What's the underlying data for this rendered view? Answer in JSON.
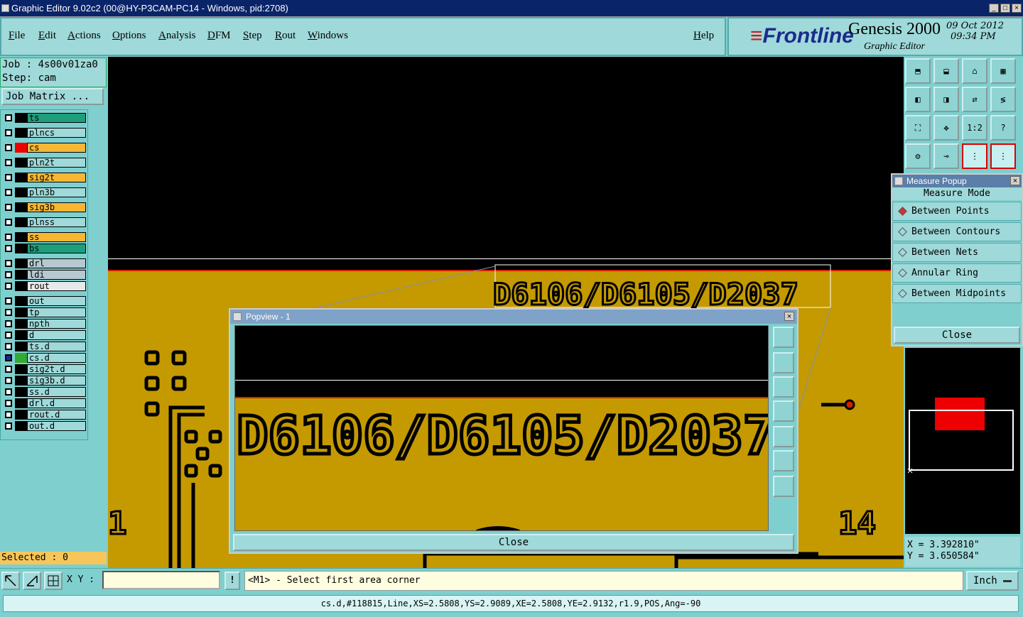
{
  "window": {
    "title": "Graphic Editor 9.02c2 (00@HY-P3CAM-PC14 - Windows, pid:2708)"
  },
  "menu": {
    "items": [
      "File",
      "Edit",
      "Actions",
      "Options",
      "Analysis",
      "DFM",
      "Step",
      "Rout",
      "Windows"
    ],
    "help": "Help"
  },
  "logo": {
    "brand": "Frontline",
    "product": "Genesis 2000",
    "subtitle": "Graphic Editor",
    "date": "09 Oct 2012",
    "time": "09:34 PM"
  },
  "job": {
    "job_line": "Job : 4s00v01za0",
    "step_line": "Step: cam",
    "matrix_button": "Job Matrix ..."
  },
  "layers": [
    {
      "name": "ts",
      "color": "#1e9e7a",
      "swatch": "#000",
      "mark": "↲"
    },
    {
      "name": "plncs",
      "color": "#9fd9d9",
      "swatch": "#000",
      "mark": ""
    },
    {
      "name": "cs",
      "color": "#f7b733",
      "swatch": "#e00",
      "mark": "↲"
    },
    {
      "name": "pln2t",
      "color": "#9fd9d9",
      "swatch": "#000",
      "mark": ""
    },
    {
      "name": "sig2t",
      "color": "#f7b733",
      "swatch": "#000",
      "mark": ""
    },
    {
      "name": "pln3b",
      "color": "#9fd9d9",
      "swatch": "#000",
      "mark": ""
    },
    {
      "name": "sig3b",
      "color": "#f7b733",
      "swatch": "#000",
      "mark": ""
    },
    {
      "name": "plnss",
      "color": "#9fd9d9",
      "swatch": "#000",
      "mark": ""
    },
    {
      "name": "ss",
      "color": "#f7b733",
      "swatch": "#000",
      "mark": "↲"
    },
    {
      "name": "bs",
      "color": "#1e9e7a",
      "swatch": "#000",
      "mark": ""
    },
    {
      "name": "drl",
      "color": "#b8c8d0",
      "swatch": "#000",
      "mark": ""
    },
    {
      "name": "ldi",
      "color": "#b8c8d0",
      "swatch": "#000",
      "mark": ""
    },
    {
      "name": "rout",
      "color": "#e8e8e8",
      "swatch": "#000",
      "mark": ""
    },
    {
      "name": "out",
      "color": "#9fd9d9",
      "swatch": "#000",
      "mark": ""
    },
    {
      "name": "tp",
      "color": "#9fd9d9",
      "swatch": "#000",
      "mark": ""
    },
    {
      "name": "npth",
      "color": "#9fd9d9",
      "swatch": "#000",
      "mark": ""
    },
    {
      "name": "d",
      "color": "#9fd9d9",
      "swatch": "#000",
      "mark": ""
    },
    {
      "name": "ts.d",
      "color": "#9fd9d9",
      "swatch": "#000",
      "mark": "↲"
    },
    {
      "name": "cs.d",
      "color": "#9fd9d9",
      "swatch": "#3a3",
      "mark": "↲⊞"
    },
    {
      "name": "sig2t.d",
      "color": "#9fd9d9",
      "swatch": "#000",
      "mark": ""
    },
    {
      "name": "sig3b.d",
      "color": "#9fd9d9",
      "swatch": "#000",
      "mark": ""
    },
    {
      "name": "ss.d",
      "color": "#9fd9d9",
      "swatch": "#000",
      "mark": "↲"
    },
    {
      "name": "drl.d",
      "color": "#9fd9d9",
      "swatch": "#000",
      "mark": ""
    },
    {
      "name": "rout.d",
      "color": "#9fd9d9",
      "swatch": "#000",
      "mark": ""
    },
    {
      "name": "out.d",
      "color": "#9fd9d9",
      "swatch": "#000",
      "mark": ""
    }
  ],
  "selected": "Selected : 0",
  "canvas": {
    "label": "D6106/D6105/D2037",
    "num_left": "1",
    "num_right": "14"
  },
  "toolbar": {
    "buttons": [
      "",
      "",
      "",
      "",
      "",
      "",
      "",
      "",
      "",
      "",
      "1:2",
      "?",
      "",
      "",
      "",
      ""
    ]
  },
  "measure": {
    "title": "Measure Popup",
    "header": "Measure Mode",
    "options": [
      "Between Points",
      "Between Contours",
      "Between Nets",
      "Annular Ring",
      "Between Midpoints"
    ],
    "selected_index": 0,
    "close": "Close"
  },
  "popview": {
    "title": "Popview - 1",
    "label": "D6106/D6105/D2037",
    "close": "Close"
  },
  "coords": {
    "x": "X = 3.392810\"",
    "y": "Y = 3.650584\""
  },
  "bottom": {
    "xy_label": "X Y :",
    "xy_value": "",
    "prompt": "<M1> - Select first area corner",
    "unit": "Inch"
  },
  "status": "cs.d,#118815,Line,XS=2.5808,YS=2.9089,XE=2.5808,YE=2.9132,r1.9,POS,Ang=-90",
  "colors": {
    "board": "#c49a00",
    "outline": "#d02000",
    "panel": "#7fcfcf",
    "highlight": "#f7b733"
  }
}
